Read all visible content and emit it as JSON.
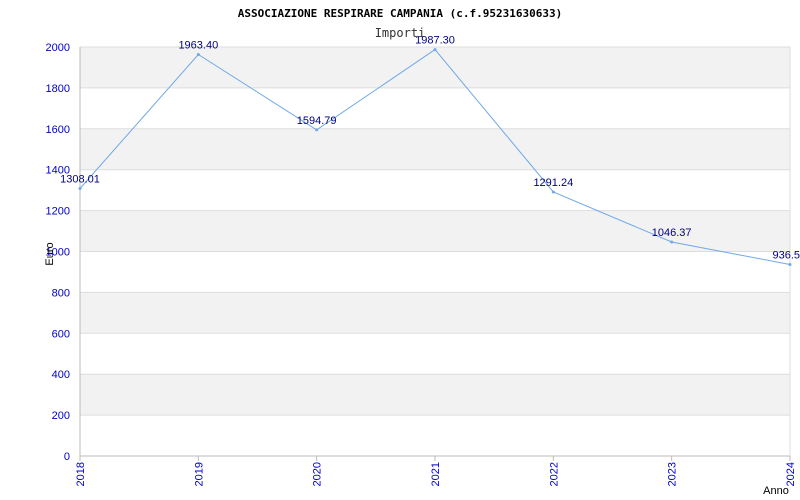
{
  "chart_data": {
    "type": "line",
    "title": "ASSOCIAZIONE RESPIRARE CAMPANIA (c.f.95231630633)",
    "subtitle": "Importi",
    "xlabel": "Anno",
    "ylabel": "Euro",
    "categories": [
      "2018",
      "2019",
      "2020",
      "2021",
      "2022",
      "2023",
      "2024"
    ],
    "series": [
      {
        "values": [
          1308.01,
          1963.4,
          1594.79,
          1987.3,
          1291.24,
          1046.37,
          936.5
        ],
        "labels": [
          "1308.01",
          "1963.40",
          "1594.79",
          "1987.30",
          "1291.24",
          "1046.37",
          "936.5"
        ]
      }
    ],
    "ylim": [
      0,
      2000
    ],
    "yticks": [
      "0",
      "200",
      "400",
      "600",
      "800",
      "1000",
      "1200",
      "1400",
      "1600",
      "1800",
      "2000"
    ],
    "grid": true,
    "colors": {
      "line": "#6fa8e8",
      "band": "#f2f2f2",
      "grid": "#dddddd",
      "axis": "#bbbbbb",
      "tick_text": "#0000cc",
      "label_text": "#000080"
    }
  }
}
